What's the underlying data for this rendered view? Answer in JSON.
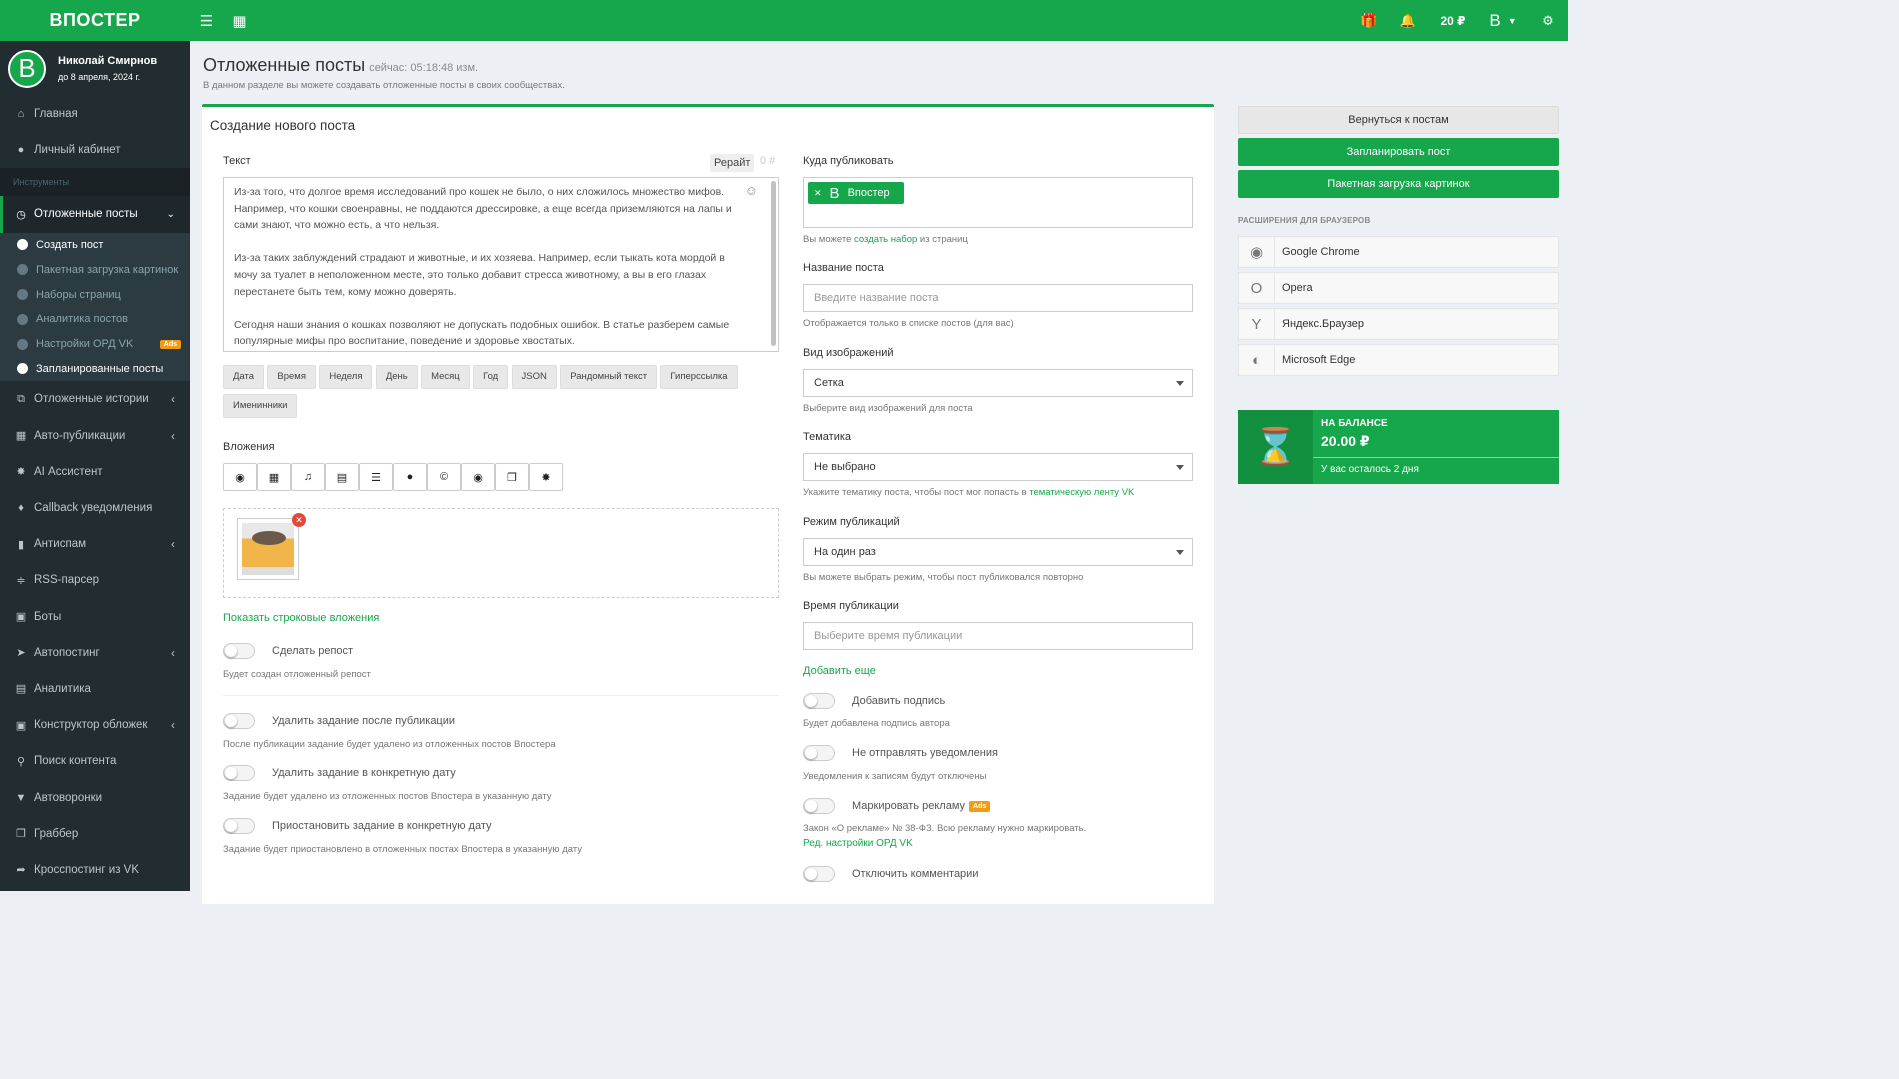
{
  "app": {
    "logo": "ВПОСТЕР",
    "balance": "20 ₽",
    "user_initial": "В"
  },
  "user": {
    "name": "Николай Смирнов",
    "until": "до 8 апреля, 2024 г.",
    "initial": "В"
  },
  "sidebar": {
    "top": [
      {
        "label": "Главная",
        "icon": "home-icon"
      },
      {
        "label": "Личный кабинет",
        "icon": "user-icon"
      }
    ],
    "tools_header": "Инструменты",
    "active": {
      "label": "Отложенные посты",
      "icon": "clock-icon"
    },
    "sub": [
      {
        "label": "Создать пост",
        "on": true
      },
      {
        "label": "Пакетная загрузка картинок"
      },
      {
        "label": "Наборы страниц"
      },
      {
        "label": "Аналитика постов"
      },
      {
        "label": "Настройки ОРД VK",
        "badge": "Ads"
      },
      {
        "label": "Запланированные посты",
        "on": true
      }
    ],
    "items": [
      {
        "label": "Отложенные истории",
        "icon": "stories-icon",
        "chev": true
      },
      {
        "label": "Авто-публикации",
        "icon": "grid-icon",
        "chev": true
      },
      {
        "label": "AI Ассистент",
        "icon": "ai-icon"
      },
      {
        "label": "Callback уведомления",
        "icon": "bell-icon"
      },
      {
        "label": "Антиспам",
        "icon": "trash-icon",
        "chev": true
      },
      {
        "label": "RSS-парсер",
        "icon": "rss-icon"
      },
      {
        "label": "Боты",
        "icon": "robot-icon"
      },
      {
        "label": "Автопостинг",
        "icon": "rocket-icon",
        "chev": true
      },
      {
        "label": "Аналитика",
        "icon": "chart-icon"
      },
      {
        "label": "Конструктор обложек",
        "icon": "image-icon",
        "chev": true
      },
      {
        "label": "Поиск контента",
        "icon": "search-icon"
      },
      {
        "label": "Автоворонки",
        "icon": "funnel-icon"
      },
      {
        "label": "Граббер",
        "icon": "copy-icon"
      },
      {
        "label": "Кросспостинг из VK",
        "icon": "share-icon"
      }
    ]
  },
  "header": {
    "title": "Отложенные посты",
    "time": "сейчас: 05:18:48 изм.",
    "desc": "В данном разделе вы можете создавать отложенные посты в своих сообществах."
  },
  "form": {
    "title": "Создание нового поста",
    "text_label": "Текст",
    "rewrite": "Рерайт",
    "counter": "0",
    "text_paragraphs": [
      "Из-за того, что долгое время исследований про кошек не было, о них сложилось множество мифов. Например, что кошки своенравны, не поддаются дрессировке, а еще всегда приземляются на лапы и сами знают, что можно есть, а что нельзя.",
      "Из-за таких заблуждений страдают и животные, и их хозяева. Например, если тыкать кота мордой в мочу за туалет в неположенном месте, это только добавит стресса животному, а вы в его глазах перестанете быть тем, кому можно доверять.",
      "Сегодня наши знания о кошках позволяют не допускать подобных ошибок. В статье разберем самые популярные мифы про воспитание, поведение и здоровье хвостатых."
    ],
    "chips": [
      "Дата",
      "Время",
      "Неделя",
      "День",
      "Месяц",
      "Год",
      "JSON",
      "Рандомный текст",
      "Гиперссылка",
      "Именинники"
    ],
    "attachments_label": "Вложения",
    "attach_icons": [
      "camera-icon",
      "film-icon",
      "music-icon",
      "file-icon",
      "list-icon",
      "map-pin-icon",
      "copyright-icon",
      "comment-icon",
      "pages-icon",
      "ai-icon"
    ],
    "show_string_attachments": "Показать строковые вложения",
    "repost": {
      "label": "Сделать репост",
      "hint": "Будет создан отложенный репост"
    },
    "delete_after": {
      "label": "Удалить задание после публикации",
      "hint": "После публикации задание будет удалено из отложенных постов Впостера"
    },
    "delete_date": {
      "label": "Удалить задание в конкретную дату",
      "hint": "Задание будет удалено из отложенных постов Впостера в указанную дату"
    },
    "pause_date": {
      "label": "Приостановить задание в конкретную дату",
      "hint": "Задание будет приостановлено в отложенных постах Впостера в указанную дату"
    },
    "where_label": "Куда публиковать",
    "where_tag": "Впостер",
    "where_hint_pre": "Вы можете ",
    "where_hint_link": "создать набор",
    "where_hint_post": " из страниц",
    "name_label": "Название поста",
    "name_placeholder": "Введите название поста",
    "name_hint": "Отображается только в списке постов (для вас)",
    "view_label": "Вид изображений",
    "view_value": "Сетка",
    "view_hint": "Выберите вид изображений для поста",
    "topic_label": "Тематика",
    "topic_value": "Не выбрано",
    "topic_hint_pre": "Укажите тематику поста, чтобы пост мог попасть в ",
    "topic_hint_link": "тематическую ленту VK",
    "mode_label": "Режим публикаций",
    "mode_value": "На один раз",
    "mode_hint": "Вы можете выбрать режим, чтобы пост публиковался повторно",
    "time_label": "Время публикации",
    "time_placeholder": "Выберите время публикации",
    "add_more": "Добавить еще",
    "signature": {
      "label": "Добавить подпись",
      "hint": "Будет добавлена подпись автора"
    },
    "no_notify": {
      "label": "Не отправлять уведомления",
      "hint": "Уведомления к записям будут отключены"
    },
    "mark_ads": {
      "label": "Маркировать рекламу",
      "badge": "Ads",
      "hint": "Закон «О рекламе» № 38-ФЗ. Всю рекламу нужно маркировать.",
      "link": "Ред. настройки ОРД VK"
    },
    "disable_comments": {
      "label": "Отключить комментарии"
    }
  },
  "right": {
    "back": "Вернуться к постам",
    "schedule": "Запланировать пост",
    "bulk": "Пакетная загрузка картинок",
    "ext_title": "РАСШИРЕНИЯ ДЛЯ БРАУЗЕРОВ",
    "exts": [
      {
        "name": "Google Chrome",
        "icon": "chrome-icon"
      },
      {
        "name": "Opera",
        "icon": "opera-icon"
      },
      {
        "name": "Яндекс.Браузер",
        "icon": "yandex-icon"
      },
      {
        "name": "Microsoft Edge",
        "icon": "edge-icon"
      }
    ],
    "balance_title": "НА БАЛАНСЕ",
    "balance_value": "20.00 ₽",
    "balance_days": "У вас осталось 2 дня"
  },
  "colors": {
    "brand": "#16a64b",
    "sidebar": "#222d32"
  }
}
